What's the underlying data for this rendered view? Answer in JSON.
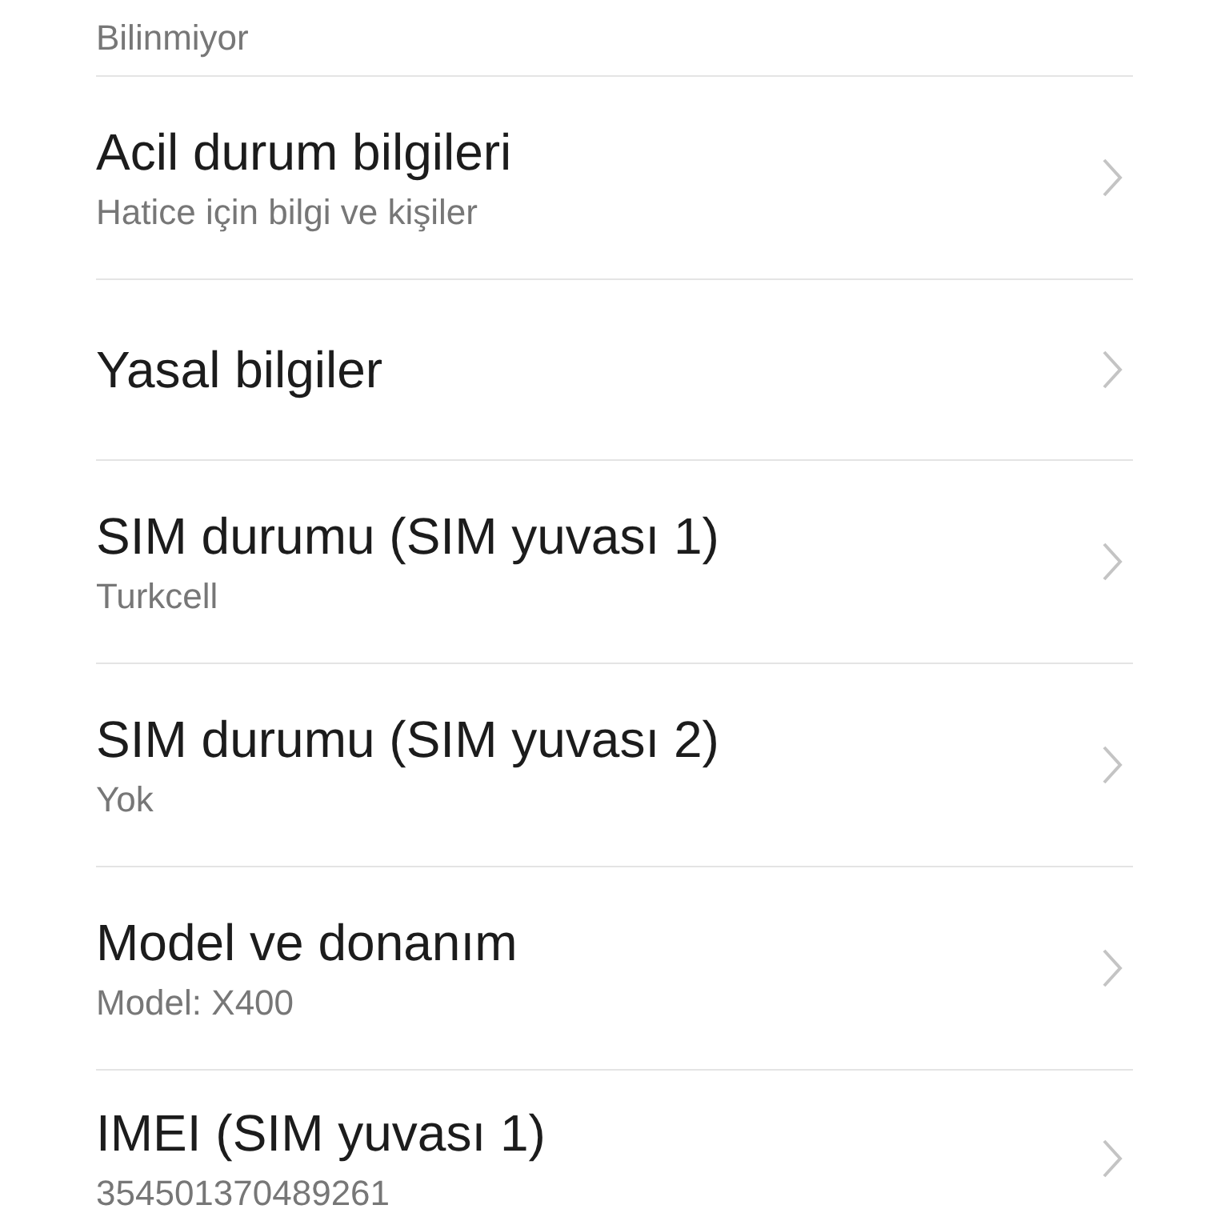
{
  "items": [
    {
      "subtitle": "Bilinmiyor",
      "chevron": false
    },
    {
      "title": "Acil durum bilgileri",
      "subtitle": "Hatice için bilgi ve kişiler",
      "chevron": true
    },
    {
      "title": "Yasal bilgiler",
      "chevron": true
    },
    {
      "title": "SIM durumu (SIM yuvası 1)",
      "subtitle": "Turkcell",
      "chevron": true
    },
    {
      "title": "SIM durumu (SIM yuvası 2)",
      "subtitle": "Yok",
      "chevron": true
    },
    {
      "title": "Model ve donanım",
      "subtitle": "Model: X400",
      "chevron": true
    },
    {
      "title": "IMEI (SIM yuvası 1)",
      "subtitle": "354501370489261",
      "chevron": true
    }
  ]
}
